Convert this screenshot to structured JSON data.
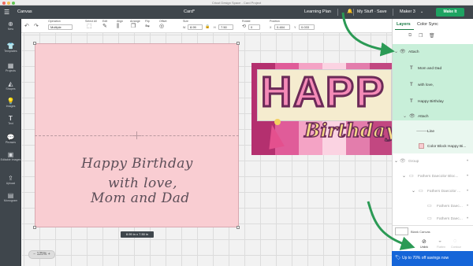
{
  "window": {
    "title": "Cricut Design Space - Card Project"
  },
  "header": {
    "canvas_label": "Canvas",
    "project_title": "Card*",
    "learning_plan": "Learning Plan",
    "my_stuff": "My Stuff",
    "save": "Save",
    "machine": "Maker 3",
    "make_it": "Make It"
  },
  "toolbar": {
    "operation_label": "Operation",
    "operation_value": "Multiple",
    "select_all": "Select All",
    "edit": "Edit",
    "align": "Align",
    "arrange": "Arrange",
    "flip": "Flip",
    "offset": "Offset",
    "size_label": "Size",
    "width_label": "W",
    "width_value": "8.99",
    "height_label": "H",
    "height_value": "7.50",
    "rotate_label": "Rotate",
    "rotate_value": "0",
    "position_label": "Position",
    "x_label": "X",
    "x_value": "0.484",
    "y_label": "Y",
    "y_value": "0.033"
  },
  "left_sidebar": [
    {
      "label": "New",
      "icon": "plus-icon"
    },
    {
      "label": "Templates",
      "icon": "shirt-icon"
    },
    {
      "label": "Projects",
      "icon": "grid-icon"
    },
    {
      "label": "Shapes",
      "icon": "shapes-icon"
    },
    {
      "label": "Images",
      "icon": "lightbulb-icon"
    },
    {
      "label": "Text",
      "icon": "text-icon"
    },
    {
      "label": "Phrases",
      "icon": "speech-bubble-icon"
    },
    {
      "label": "Editable Images",
      "icon": "edit-image-icon"
    },
    {
      "label": "Upload",
      "icon": "upload-icon"
    },
    {
      "label": "Monogram",
      "icon": "monogram-icon"
    }
  ],
  "card_text": {
    "line1": "Happy Birthday",
    "line2": "with love,",
    "line3": "Mom and Dad"
  },
  "design": {
    "big_text": "HAPP",
    "script_text": "Birthday"
  },
  "canvas": {
    "size_label": "8.99 in x 7.50 in",
    "zoom": "125%"
  },
  "right_panel": {
    "tabs": [
      "Layers",
      "Color Sync"
    ],
    "layers": [
      {
        "label": "Attach",
        "icon": "eye-icon",
        "highlight": true
      },
      {
        "label": "Mom and Dad",
        "icon": "text-layer-icon",
        "highlight": true
      },
      {
        "label": "with love,",
        "icon": "text-layer-icon",
        "highlight": true
      },
      {
        "label": "Happy Birthday",
        "icon": "text-layer-icon",
        "highlight": true
      },
      {
        "label": "Attach",
        "icon": "eye-icon",
        "highlight": true
      },
      {
        "label": "Line",
        "icon": "line-icon",
        "highlight": false
      },
      {
        "label": "Color Block Happy Bi...",
        "icon": "swatch-icon",
        "highlight": false
      },
      {
        "label": "Group",
        "icon": "eye-icon",
        "highlight": false
      },
      {
        "label": "Fathers Daecolor Bloc...",
        "icon": "image-icon",
        "highlight": false
      },
      {
        "label": "Fathers Daecolor ...",
        "icon": "image-icon",
        "highlight": false
      },
      {
        "label": "Fathers Daec...",
        "icon": "image-icon",
        "highlight": false
      },
      {
        "label": "Fathers Daec...",
        "icon": "image-icon",
        "highlight": false
      }
    ],
    "blank_canvas": "Blank Canvas",
    "bottom_actions": [
      "Unlink",
      "Flatten",
      "Contour"
    ],
    "promo": "Up to 70% off savings now"
  },
  "colors": {
    "accent_green": "#1ea362",
    "arrow_green": "#2b9a55",
    "card_pink": "#f9cdd2",
    "header_dark": "#3f464c",
    "promo_blue": "#1565d8"
  }
}
